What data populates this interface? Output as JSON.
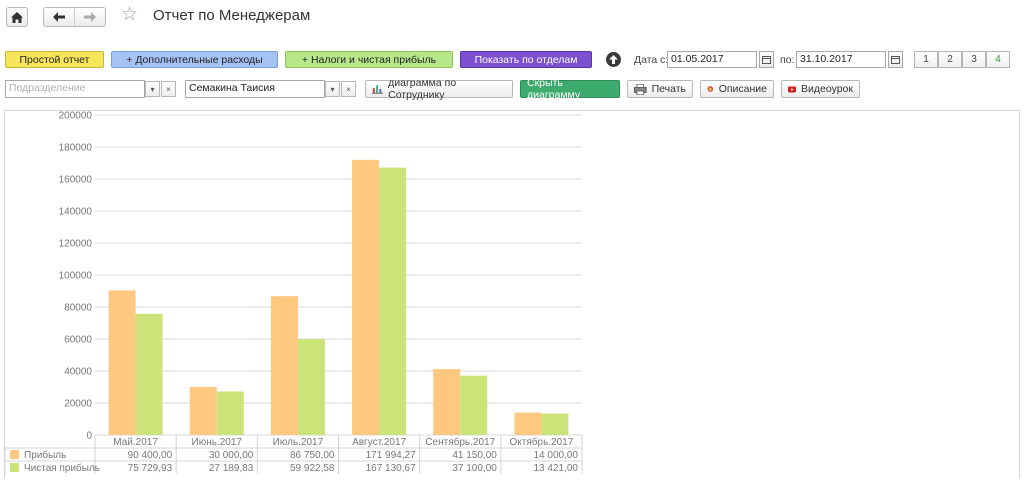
{
  "page": {
    "title": "Отчет по Менеджерам"
  },
  "nav": {
    "home_icon": "home-icon",
    "back_icon": "arrow-left-icon",
    "forward_icon": "arrow-right-icon",
    "star_icon": "star-icon"
  },
  "toolbar": {
    "simple_report": "Простой отчет",
    "extra_expenses": "+ Дополнительные расходы",
    "taxes_profit": "+ Налоги и чистая прибыль",
    "show_by_depts": "Показать по отделам",
    "date_from_label": "Дата с:",
    "date_from": "01.05.2017",
    "date_to_label": "по:",
    "date_to": "31.10.2017",
    "pages": [
      "1",
      "2",
      "3",
      "4"
    ],
    "active_page": "4"
  },
  "filters": {
    "department_placeholder": "Подразделение",
    "employee": "Семакина Таисия",
    "chart_by_employee": "диаграмма по Сотруднику",
    "hide_chart": "Скрыть диаграмму",
    "print": "Печать",
    "description": "Описание",
    "video": "Видеоурок"
  },
  "colors": {
    "simple": "#f7e65b",
    "extra": "#a4c2f4",
    "taxes": "#b6e88a",
    "depts": "#7b4fcf",
    "hide": "#3dab6d",
    "profit": "#ffc880",
    "net_profit": "#cce37a",
    "active_page": "#2e9b3a"
  },
  "chart_data": {
    "type": "bar",
    "categories": [
      "Май.2017",
      "Июнь.2017",
      "Июль.2017",
      "Август.2017",
      "Сентябрь.2017",
      "Октябрь.2017"
    ],
    "series": [
      {
        "name": "Прибыль",
        "values": [
          90400,
          30000,
          86750,
          171994.27,
          41150,
          14000
        ],
        "labels": [
          "90 400,00",
          "30 000,00",
          "86 750,00",
          "171 994,27",
          "41 150,00",
          "14 000,00"
        ]
      },
      {
        "name": "Чистая прибыль",
        "values": [
          75729.93,
          27189.83,
          59922.58,
          167130.67,
          37100,
          13421
        ],
        "labels": [
          "75 729,93",
          "27 189,83",
          "59 922,58",
          "167 130,67",
          "37 100,00",
          "13 421,00"
        ]
      }
    ],
    "yticks": [
      "0",
      "20000",
      "40000",
      "60000",
      "80000",
      "100000",
      "120000",
      "140000",
      "160000",
      "180000",
      "200000"
    ],
    "ylim": [
      0,
      200000
    ],
    "grid": true,
    "legend": "table-bottom"
  }
}
